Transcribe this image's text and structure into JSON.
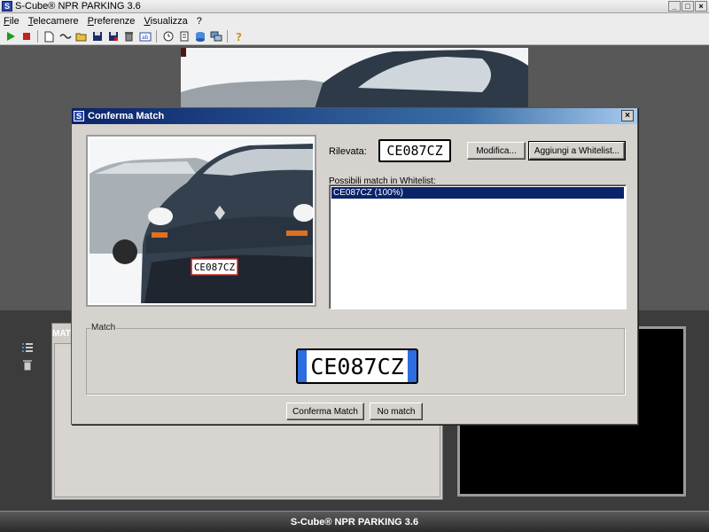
{
  "window": {
    "title": "S-Cube® NPR PARKING 3.6",
    "icon_letter": "S",
    "controls": [
      "_",
      "□",
      "×"
    ]
  },
  "menu": {
    "items": [
      {
        "label_ul": "F",
        "label_rest": "ile"
      },
      {
        "label_ul": "T",
        "label_rest": "elecamere"
      },
      {
        "label_ul": "P",
        "label_rest": "referenze"
      },
      {
        "label_ul": "V",
        "label_rest": "isualizza"
      },
      {
        "label_ul": "",
        "label_rest": "?"
      }
    ]
  },
  "toolbar": {
    "icons": [
      "play-icon",
      "stop-icon",
      "new-file-icon",
      "connect-icon",
      "open-folder-icon",
      "save-icon",
      "save-as-icon",
      "delete-icon",
      "rename-icon",
      "clock-icon",
      "document-icon",
      "database-icon",
      "network-icon",
      "help-icon"
    ]
  },
  "background": {
    "match_panel_label": "MATC",
    "statusbar_text": "S-Cube® NPR PARKING 3.6"
  },
  "dialog": {
    "title": "Conferma Match",
    "icon_letter": "S",
    "close_label": "×",
    "rilevata_label": "Rilevata:",
    "detected_plate": "CE087CZ",
    "modifica_label": "Modifica...",
    "add_whitelist_label": "Aggiungi a Whitelist...",
    "whitelist_label": "Possibili match in Whitelist:",
    "whitelist_items": [
      "CE087CZ (100%)"
    ],
    "match_group_label": "Match",
    "match_plate": "CE087CZ",
    "confirm_label": "Conferma Match",
    "nomatch_label": "No match"
  },
  "colors": {
    "selection": "#0a246a",
    "plate_band": "#2c6de0",
    "dialog_bg": "#d6d2ce"
  }
}
